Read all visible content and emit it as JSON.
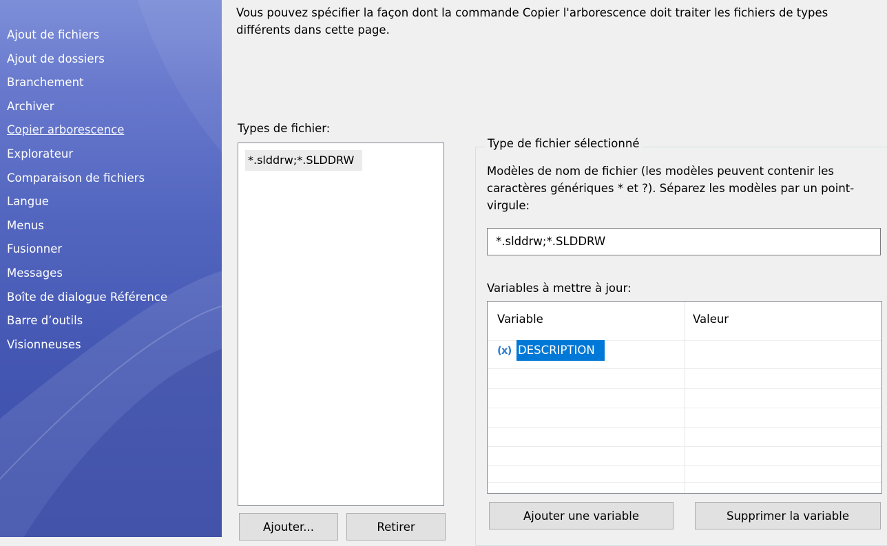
{
  "sidebar": {
    "items": [
      {
        "label": "Ajout de fichiers",
        "active": false
      },
      {
        "label": "Ajout de dossiers",
        "active": false
      },
      {
        "label": "Branchement",
        "active": false
      },
      {
        "label": "Archiver",
        "active": false
      },
      {
        "label": "Copier arborescence",
        "active": true
      },
      {
        "label": "Explorateur",
        "active": false
      },
      {
        "label": "Comparaison de fichiers",
        "active": false
      },
      {
        "label": "Langue",
        "active": false
      },
      {
        "label": "Menus",
        "active": false
      },
      {
        "label": "Fusionner",
        "active": false
      },
      {
        "label": "Messages",
        "active": false
      },
      {
        "label": "Boîte de dialogue Référence",
        "active": false
      },
      {
        "label": "Barre d’outils",
        "active": false
      },
      {
        "label": "Visionneuses",
        "active": false
      }
    ]
  },
  "description": "Vous pouvez spécifier la façon dont la commande Copier l'arborescence doit traiter les fichiers de types différents dans cette page.",
  "file_types": {
    "label": "Types de fichier:",
    "items": [
      "*.slddrw;*.SLDDRW"
    ],
    "add_button": "Ajouter...",
    "remove_button": "Retirer"
  },
  "selected_type": {
    "group_title": "Type de fichier sélectionné",
    "patterns_help": "Modèles de nom de fichier (les modèles peuvent contenir les caractères génériques * et ?). Séparez les modèles par un point-virgule:",
    "patterns_value": "*.slddrw;*.SLDDRW",
    "variables_label": "Variables à mettre à jour:",
    "columns": {
      "variable": "Variable",
      "value": "Valeur"
    },
    "rows": [
      {
        "icon": "variable-icon",
        "icon_glyph": "(x)",
        "name": "DESCRIPTION",
        "value": ""
      }
    ],
    "add_variable_button": "Ajouter une variable",
    "delete_variable_button": "Supprimer la variable"
  },
  "colors": {
    "sidebar_top": "#7d8ed8",
    "sidebar_bottom": "#3a4ca8",
    "selection": "#0078d7",
    "variable_icon": "#2d7fd0"
  }
}
